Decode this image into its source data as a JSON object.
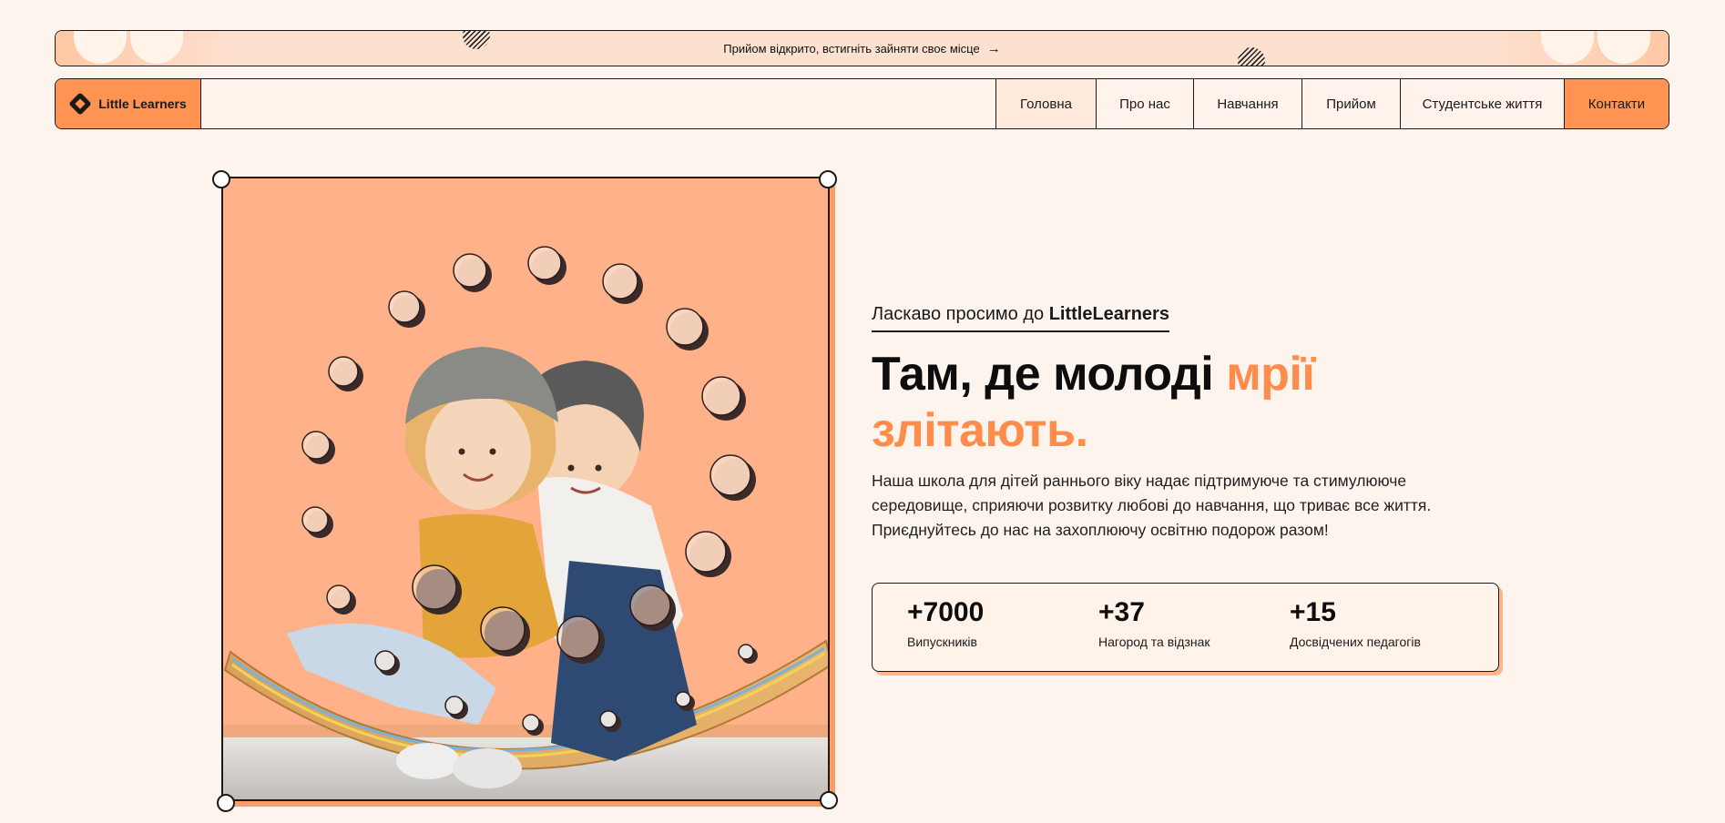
{
  "announcement": {
    "text": "Прийом відкрито, встигніть зайняти своє місце",
    "arrow": "→"
  },
  "brand": {
    "name": "Little Learners",
    "accent_color": "#ff9352",
    "background": "#fdf4ee"
  },
  "nav": {
    "items": [
      {
        "label": "Головна",
        "active": true
      },
      {
        "label": "Про нас"
      },
      {
        "label": "Навчання"
      },
      {
        "label": "Прийом"
      },
      {
        "label": "Студентське життя"
      }
    ],
    "cta_label": "Контакти"
  },
  "hero": {
    "welcome_prefix": "Ласкаво просимо до",
    "welcome_brand": "LittleLearners",
    "headline_part1": "Там, де молоді",
    "headline_accent1": "мрії",
    "headline_accent2": "злітають.",
    "description": "Наша школа для дітей раннього віку надає підтримуюче та стимулююче середовище, сприяючи розвитку любові до навчання, що триває все життя. Приєднуйтесь до нас на захоплюючу освітню подорож разом!",
    "image_icon": "children-photo"
  },
  "stats": [
    {
      "number": "+7000",
      "label": "Випускників"
    },
    {
      "number": "+37",
      "label": "Нагород та відзнак"
    },
    {
      "number": "+15",
      "label": "Досвідчених педагогів"
    }
  ]
}
